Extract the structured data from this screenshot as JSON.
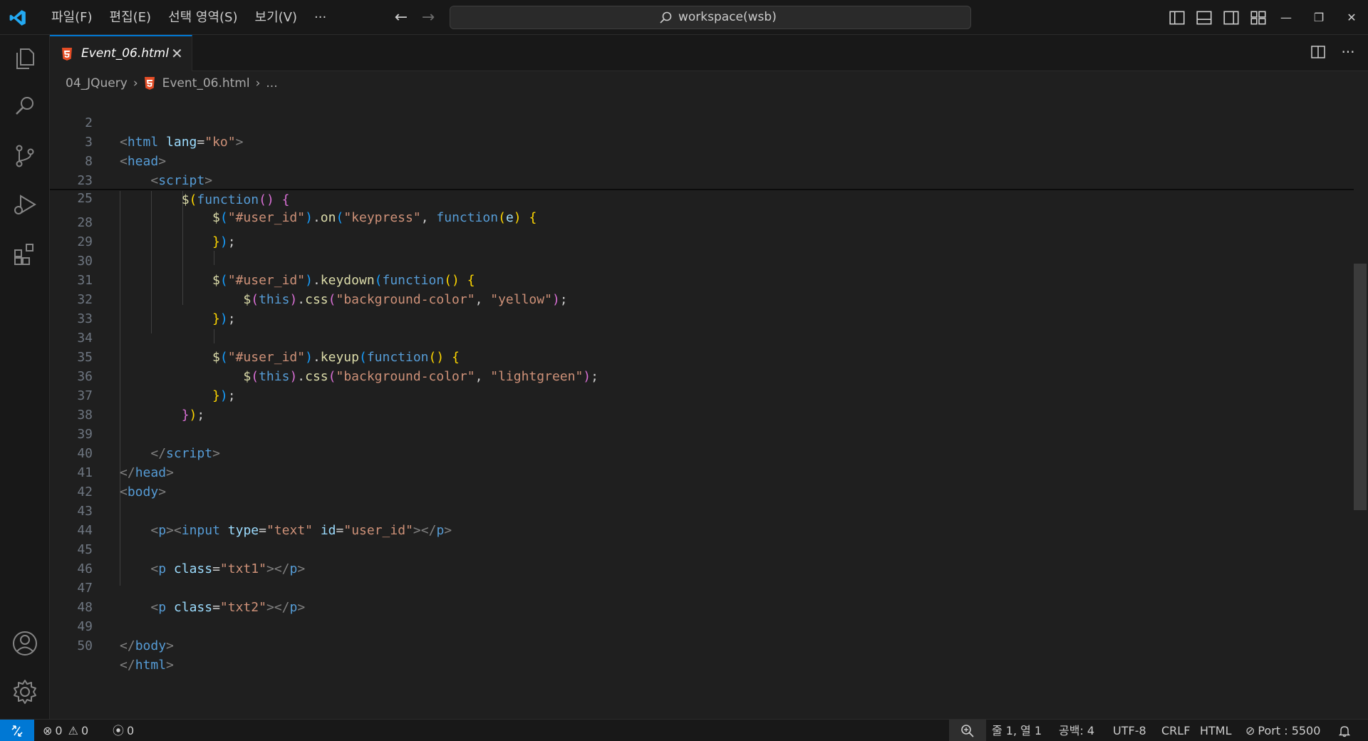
{
  "menu": {
    "items": [
      "파일(F)",
      "편집(E)",
      "선택 영역(S)",
      "보기(V)",
      "···"
    ]
  },
  "search": {
    "text": "workspace(wsb)"
  },
  "tab": {
    "label": "Event_06.html",
    "close": "✕"
  },
  "breadcrumb": {
    "folder": "04_JQuery",
    "file": "Event_06.html",
    "more": "..."
  },
  "code_lines": [
    {
      "n": "2"
    },
    {
      "n": "3"
    },
    {
      "n": "8"
    },
    {
      "n": "23"
    },
    {
      "n": "25"
    },
    {
      "n": "28"
    },
    {
      "n": "29"
    },
    {
      "n": "30"
    },
    {
      "n": "31"
    },
    {
      "n": "32"
    },
    {
      "n": "33"
    },
    {
      "n": "34"
    },
    {
      "n": "35"
    },
    {
      "n": "36"
    },
    {
      "n": "37"
    },
    {
      "n": "38"
    },
    {
      "n": "39"
    },
    {
      "n": "40"
    },
    {
      "n": "41"
    },
    {
      "n": "42"
    },
    {
      "n": "43"
    },
    {
      "n": "44"
    },
    {
      "n": "45"
    },
    {
      "n": "46"
    },
    {
      "n": "47"
    },
    {
      "n": "48"
    },
    {
      "n": "49"
    },
    {
      "n": "50"
    }
  ],
  "code": {
    "t_lt": "<",
    "t_gt": ">",
    "t_close_lt": "</",
    "html": "html",
    "lang": "lang",
    "eq": "=",
    "ko": "\"ko\"",
    "head": "head",
    "script": "script",
    "dollar": "$",
    "function": "function",
    "paren_open": "(",
    "paren_close": ")",
    "brace_open": "{",
    "brace_close": "}",
    "sel_user_id": "\"#user_id\"",
    "dot": ".",
    "on": "on",
    "keypress": "\"keypress\"",
    "comma": ",",
    "e": "e",
    "semicolon": ";",
    "keydown": "keydown",
    "keyup": "keyup",
    "this": "this",
    "css": "css",
    "bg_color": "\"background-color\"",
    "yellow": "\"yellow\"",
    "lightgreen": "\"lightgreen\"",
    "body": "body",
    "p": "p",
    "input": "input",
    "type": "type",
    "text_val": "\"text\"",
    "id_attr": "id",
    "user_id_val": "\"user_id\"",
    "class_attr": "class",
    "txt1": "\"txt1\"",
    "txt2": "\"txt2\""
  },
  "status": {
    "errors": "0",
    "warnings": "0",
    "ports": "0",
    "position": "줄 1, 열 1",
    "spaces": "공백: 4",
    "encoding": "UTF-8",
    "eol": "CRLF",
    "language": "HTML",
    "port": "Port : 5500"
  },
  "colors": {
    "accent": "#0078d4",
    "html_icon": "#e44d26"
  }
}
